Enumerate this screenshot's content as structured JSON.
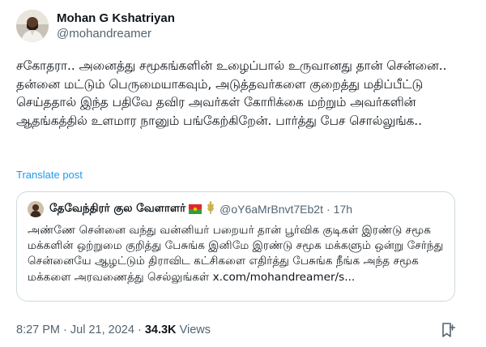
{
  "author": {
    "name": "Mohan G Kshatriyan",
    "handle": "@mohandreamer"
  },
  "tweet": {
    "text": "சகோதரா.. அனைத்து சமூகங்களின் உழைப்பால் உருவானது தான் சென்னை.. தன்னை மட்டும் பெருமையாகவும், அடுத்தவர்களை குறைத்து மதிப்பீட்டு செய்ததால் இந்த பதிவே தவிர அவர்கள் கோரிக்கை மற்றும் அவர்களின் ஆதங்கத்தில் உளமார நானும் பங்கேற்கிறேன். பார்த்து பேச சொல்லுங்க..",
    "translate_label": "Translate post"
  },
  "quote": {
    "name": "தேவேந்திரர் குல வேளாளர்",
    "handle": "@oY6aMrBnvt7Eb2t",
    "separator": "·",
    "time": "17h",
    "text": "அண்ணே சென்னை வந்து வன்னியர் பறையர் தான் பூர்விக குடிகள் இரண்டு சமூக மக்களின் ஒற்றுமை குறித்து பேசுங்க இனிமே இரண்டு சமூக மக்களும் ஒன்று சேர்ந்து சென்னையே ஆழட்டும் திராவிட கட்சிகளை எதிர்த்து பேசுங்க நீங்க அந்த சமூக மக்களை அரவணைத்து செல்லுங்கள் x.com/mohandreamer/s..."
  },
  "footer": {
    "time": "8:27 PM",
    "separator": "·",
    "date": "Jul 21, 2024",
    "views_count": "34.3K",
    "views_label": "Views"
  },
  "icons": {
    "quote_badges": [
      "flag-icon",
      "wheat-icon"
    ],
    "bookmark": "bookmark-icon"
  },
  "colors": {
    "link": "#1d9bf0",
    "secondary_text": "#536471",
    "primary_text": "#0f1419",
    "border": "#cfd9de"
  }
}
